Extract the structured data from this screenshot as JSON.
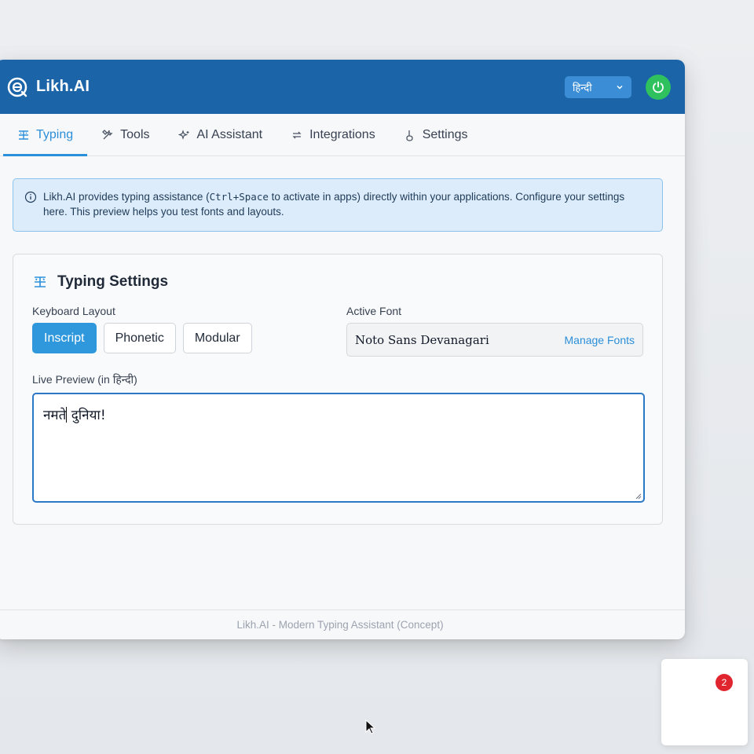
{
  "app": {
    "title": "Likh.AI"
  },
  "header": {
    "language_selected": "हिन्दी"
  },
  "tabs": [
    {
      "label": "Typing",
      "icon": "typing-icon",
      "active": true
    },
    {
      "label": "Tools",
      "icon": "tools-icon",
      "active": false
    },
    {
      "label": "AI Assistant",
      "icon": "sparkle-icon",
      "active": false
    },
    {
      "label": "Integrations",
      "icon": "integrations-icon",
      "active": false
    },
    {
      "label": "Settings",
      "icon": "settings-icon",
      "active": false
    }
  ],
  "info": {
    "text_before": "Likh.AI provides typing assistance (",
    "shortcut": "Ctrl+Space",
    "text_after": " to activate in apps) directly within your applications. Configure your settings here. This preview helps you test fonts and layouts."
  },
  "typing_settings": {
    "title": "Typing Settings",
    "keyboard_layout_label": "Keyboard Layout",
    "layouts": [
      "Inscript",
      "Phonetic",
      "Modular"
    ],
    "active_layout": "Inscript",
    "active_font_label": "Active Font",
    "active_font": "Noto Sans Devanagari",
    "manage_fonts_label": "Manage Fonts",
    "preview_label": "Live Preview (in हिन्दी)",
    "preview_text_before_caret": "नमते",
    "preview_text_after_caret": " दुनिया!"
  },
  "footer": {
    "text": "Likh.AI - Modern Typing Assistant (Concept)"
  },
  "notification": {
    "count": "2"
  },
  "colors": {
    "header_bg": "#1b64a8",
    "accent": "#2b8fd9",
    "power": "#2fc15d",
    "badge": "#e0252f"
  }
}
